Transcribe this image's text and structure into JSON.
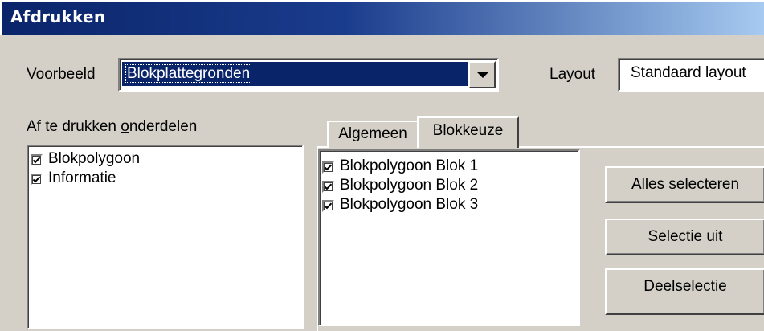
{
  "window": {
    "title": "Afdrukken"
  },
  "preview": {
    "label": "Voorbeeld",
    "value": "Blokplattegronden"
  },
  "layout": {
    "label": "Layout",
    "value": "Standaard layout"
  },
  "parts": {
    "label_prefix": "Af te drukken ",
    "label_accel": "o",
    "label_suffix": "nderdelen",
    "items": [
      {
        "label": "Blokpolygoon",
        "checked": true
      },
      {
        "label": "Informatie",
        "checked": true
      }
    ]
  },
  "tabs": [
    {
      "label": "Algemeen",
      "active": false
    },
    {
      "label": "Blokkeuze",
      "active": true
    }
  ],
  "blocks": {
    "items": [
      {
        "label": "Blokpolygoon Blok 1",
        "checked": true
      },
      {
        "label": "Blokpolygoon Blok 2",
        "checked": true
      },
      {
        "label": "Blokpolygoon Blok 3",
        "checked": true
      }
    ]
  },
  "buttons": {
    "select_all": "Alles selecteren",
    "deselect": "Selectie uit",
    "partial": "Deelselectie"
  }
}
